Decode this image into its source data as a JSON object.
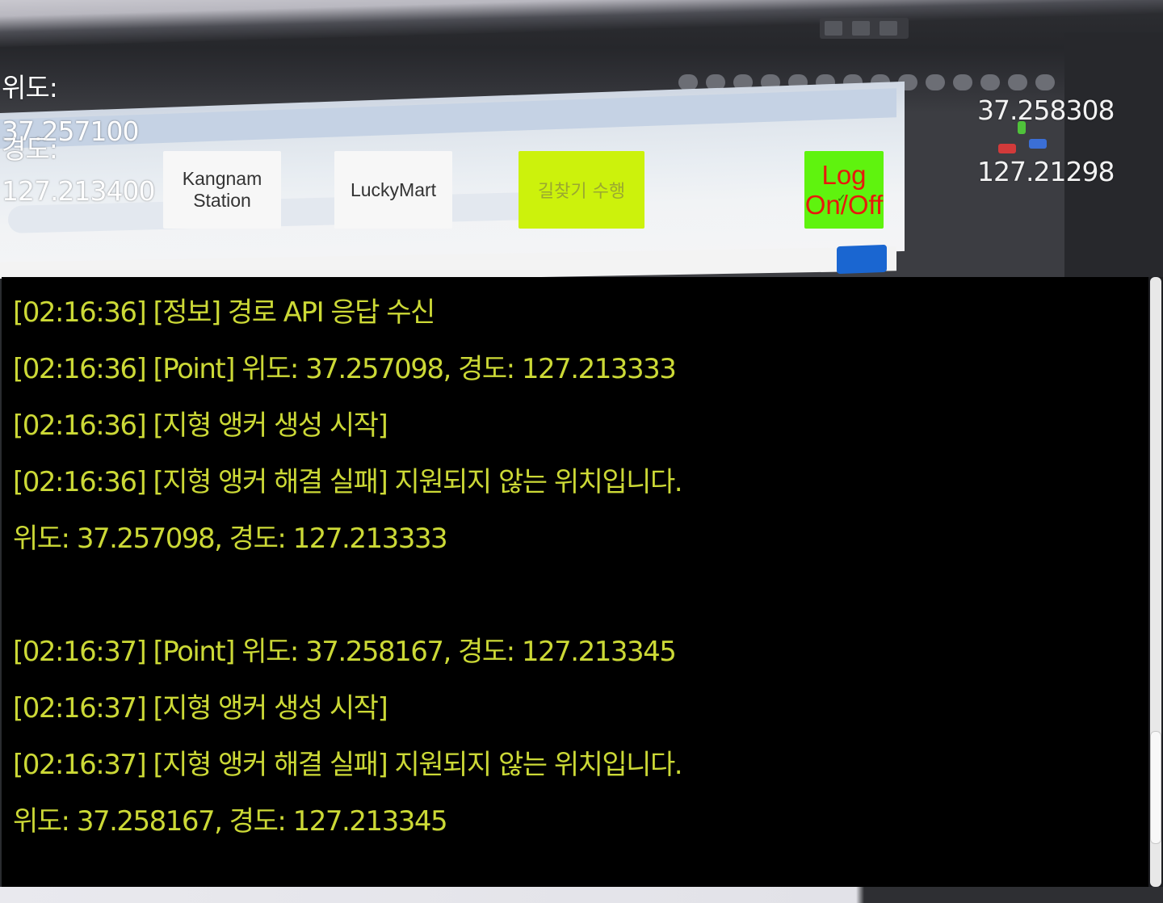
{
  "coordinates_left": {
    "lat_label": "위도:",
    "lat_value": "37.257100",
    "lng_label": "경도:",
    "lng_value": "127.213400"
  },
  "coordinates_right": {
    "lat_value": "37.258308",
    "lng_value": "127.21298"
  },
  "buttons": {
    "kangnam": "Kangnam Station",
    "luckymart": "LuckyMart",
    "route": "길찾기 수행",
    "log_toggle_line1": "Log",
    "log_toggle_line2": "On/Off"
  },
  "log": [
    "[02:16:36] [정보] 경로 API 응답 수신",
    "[02:16:36] [Point] 위도: 37.257098, 경도: 127.213333",
    "[02:16:36] [지형 앵커 생성 시작]",
    "[02:16:36] [지형 앵커 해결 실패] 지원되지 않는 위치입니다.",
    "위도: 37.257098, 경도: 127.213333",
    "",
    "[02:16:37] [Point] 위도: 37.258167, 경도: 127.213345",
    "[02:16:37] [지형 앵커 생성 시작]",
    "[02:16:37] [지형 앵커 해결 실패] 지원되지 않는 위치입니다.",
    "위도: 37.258167, 경도: 127.213345"
  ],
  "colors": {
    "log_text": "#ccd936",
    "route_button_bg": "#ccf20c",
    "log_button_bg": "#5ff30e",
    "log_button_text": "#e8180c"
  }
}
